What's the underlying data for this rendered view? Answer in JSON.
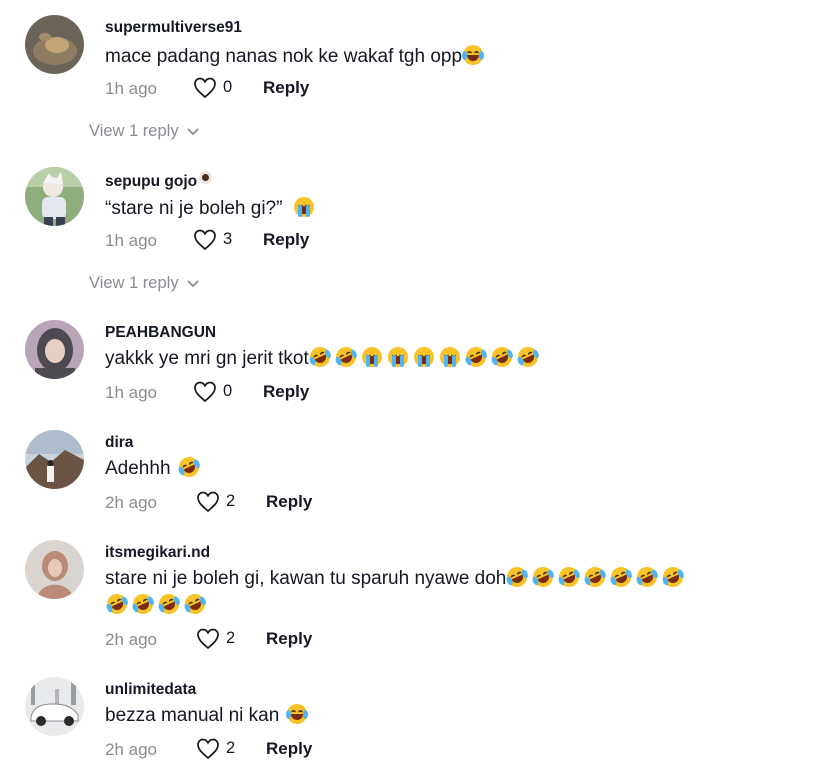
{
  "colors": {
    "text": "#161823",
    "muted": "#8a8b91",
    "emoji_face": "#f7c329",
    "tear": "#4fb4f2"
  },
  "comments": [
    {
      "username": "supermultiverse91",
      "text": "mace padang nanas nok ke wakaf tgh opp",
      "emoji_after": [
        "tears-of-joy"
      ],
      "time": "1h ago",
      "likes": "0",
      "reply_label": "Reply",
      "view_replies": "View 1 reply"
    },
    {
      "username": "sepupu gojo",
      "username_emoji": "coffee-icon",
      "text": "“stare ni je boleh gi?”",
      "emoji_after": [
        "loudly-crying"
      ],
      "time": "1h ago",
      "likes": "3",
      "reply_label": "Reply",
      "view_replies": "View 1 reply"
    },
    {
      "username": "PEAHBANGUN",
      "text": "yakkk ye mri gn jerit tkot",
      "emoji_after": [
        "rofl",
        "rofl",
        "loudly-crying",
        "loudly-crying",
        "loudly-crying",
        "loudly-crying",
        "rofl",
        "rofl",
        "rofl"
      ],
      "time": "1h ago",
      "likes": "0",
      "reply_label": "Reply"
    },
    {
      "username": "dira",
      "text": "Adehhh",
      "emoji_after": [
        "rofl"
      ],
      "time": "2h ago",
      "likes": "2",
      "reply_label": "Reply"
    },
    {
      "username": "itsmegikari.nd",
      "text": "stare ni je boleh gi, kawan tu sparuh nyawe doh",
      "emoji_after": [
        "rofl",
        "rofl",
        "rofl",
        "rofl",
        "rofl",
        "rofl",
        "rofl"
      ],
      "emoji_line2": [
        "rofl",
        "rofl",
        "rofl",
        "rofl"
      ],
      "time": "2h ago",
      "likes": "2",
      "reply_label": "Reply"
    },
    {
      "username": "unlimitedata",
      "text": "bezza manual ni kan",
      "emoji_after": [
        "tears-of-joy"
      ],
      "time": "2h ago",
      "likes": "2",
      "reply_label": "Reply"
    }
  ]
}
